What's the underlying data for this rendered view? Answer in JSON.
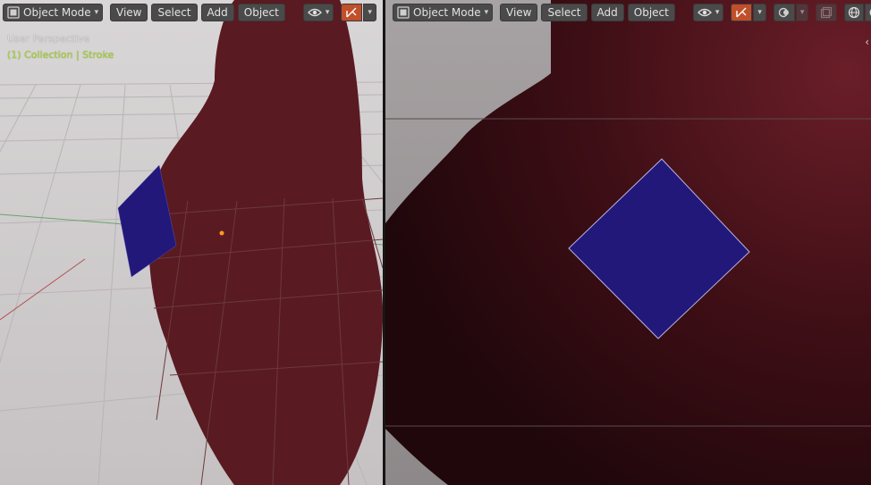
{
  "left_viewport": {
    "header": {
      "mode_label": "Object Mode",
      "menus": [
        "View",
        "Select",
        "Add",
        "Object"
      ]
    },
    "overlay": {
      "title": "User Perspective",
      "collection": "(1) Collection | Stroke"
    }
  },
  "right_viewport": {
    "header": {
      "mode_label": "Object Mode",
      "menus": [
        "View",
        "Select",
        "Add",
        "Object"
      ]
    }
  },
  "icons": {
    "editor_type": "viewport-editor-icon",
    "visibility": "eye-icon",
    "gizmo": "gizmo-icon",
    "overlay": "overlay-icon",
    "xray": "xray-icon",
    "shading_wire": "wireframe-shading-icon",
    "shading_solid": "solid-shading-icon",
    "shading_material": "material-shading-icon",
    "shading_render": "rendered-shading-icon"
  },
  "colors": {
    "header_bg": "#4a4a4a",
    "active_toggle": "#c04f2a",
    "stroke_fill": "#5a1a22",
    "plane_fill": "#22187a",
    "collection_text": "#a3d82a",
    "grid_bg": "#cfcbcc"
  }
}
